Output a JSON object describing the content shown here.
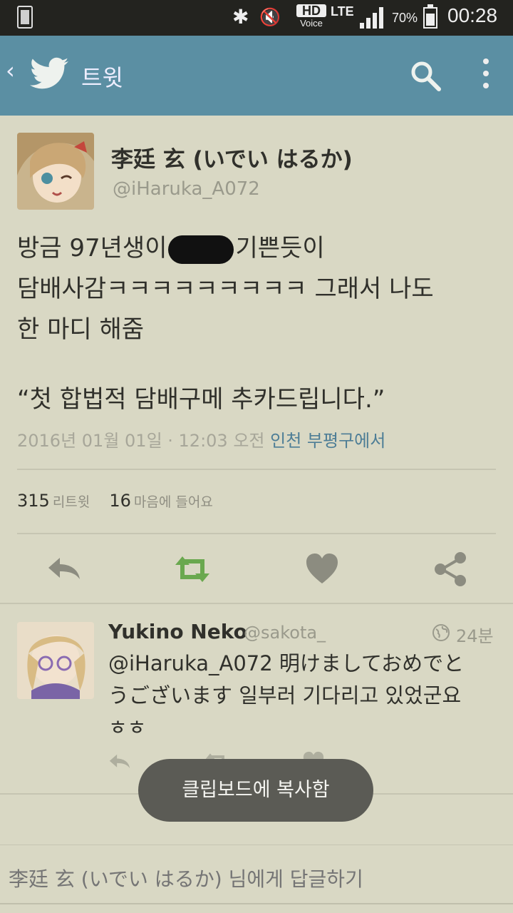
{
  "status_bar": {
    "hd_label": "HD",
    "voice_label": "Voice",
    "network": "LTE",
    "battery_percent": "70%",
    "time": "00:28",
    "icons": [
      "notification-icon",
      "bluetooth-icon",
      "mute-icon",
      "signal-icon",
      "battery-icon"
    ]
  },
  "app_bar": {
    "title": "트윗",
    "icons": [
      "back-icon",
      "twitter-bird-icon",
      "search-icon",
      "more-vert-icon"
    ],
    "accent_color": "#5b8fa3"
  },
  "tweet": {
    "author_name": "李廷 玄 (いでい はるか)",
    "author_handle": "@iHaruka_A072",
    "text_line1_before": "방금 97년생이",
    "text_line1_after": "기쁜듯이",
    "text_line2": "담배사감ㅋㅋㅋㅋㅋㅋㅋㅋㅋ 그래서 나도",
    "text_line3": "한 마디 해줌",
    "quote": "“첫 합법적 담배구메 추카드립니다.”",
    "timestamp": "2016년 01월 01일 · 12:03 오전",
    "location": "인천 부평구에서",
    "retweet_count": "315",
    "retweet_label": "리트윗",
    "like_count": "16",
    "like_label": "마음에 들어요"
  },
  "reply": {
    "name": "Yukino Neko",
    "handle": "@sakota_",
    "time": "24분",
    "text_line1": "@iHaruka_A072 明けましておめでと",
    "text_line2": "うございます 일부러 기다리고 있었군요",
    "text_line3": "ㅎㅎ"
  },
  "toast": {
    "message": "클립보드에 복사함"
  },
  "reply_input": {
    "placeholder": "李廷 玄 (いでい はるか) 님에게 답글하기"
  },
  "colors": {
    "background": "#d9d8c4",
    "retweet_green": "#6aa84f",
    "icon_gray": "#8c8c80"
  }
}
